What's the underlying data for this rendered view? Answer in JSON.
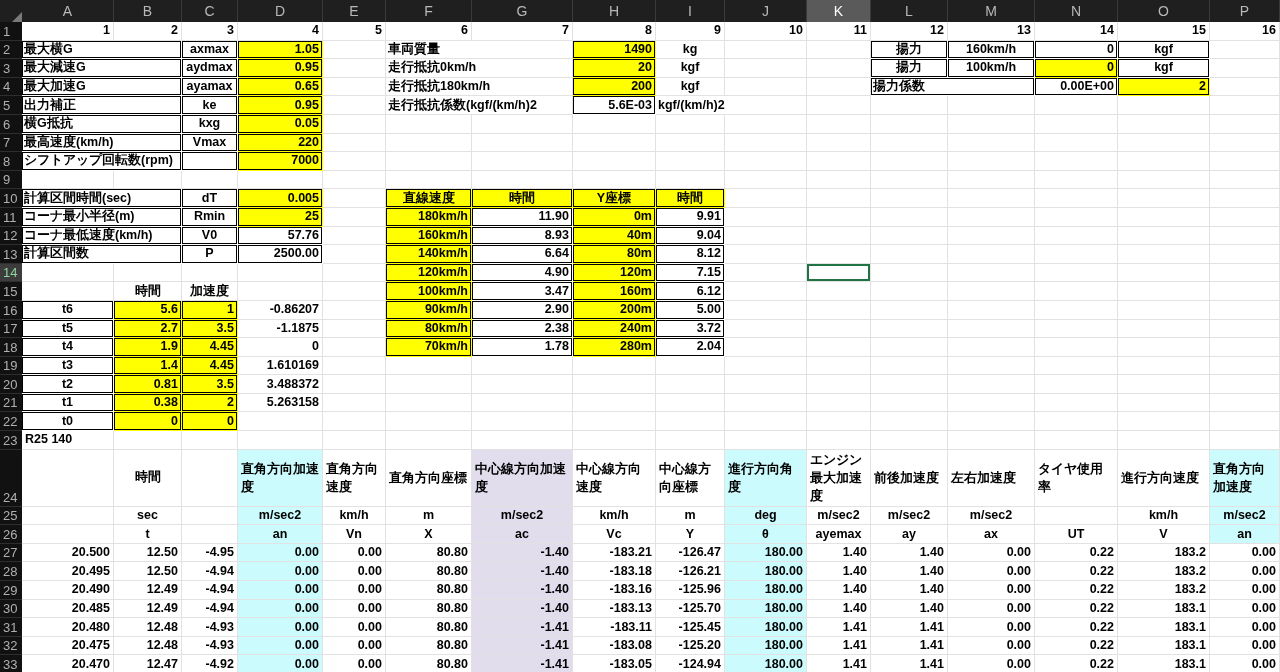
{
  "columns": [
    {
      "label": "A",
      "selected": false
    },
    {
      "label": "B",
      "selected": false
    },
    {
      "label": "C",
      "selected": false
    },
    {
      "label": "D",
      "selected": false
    },
    {
      "label": "E",
      "selected": false
    },
    {
      "label": "F",
      "selected": false
    },
    {
      "label": "G",
      "selected": false
    },
    {
      "label": "H",
      "selected": false
    },
    {
      "label": "I",
      "selected": false
    },
    {
      "label": "J",
      "selected": false
    },
    {
      "label": "K",
      "selected": true
    },
    {
      "label": "L",
      "selected": false
    },
    {
      "label": "M",
      "selected": false
    },
    {
      "label": "N",
      "selected": false
    },
    {
      "label": "O",
      "selected": false
    },
    {
      "label": "P",
      "selected": false
    }
  ],
  "rows": [
    {
      "number": "1",
      "selected": false,
      "cells": [
        {
          "text": "1",
          "kind": "number"
        },
        {
          "text": "2",
          "kind": "number"
        },
        {
          "text": "3",
          "kind": "number"
        },
        {
          "text": "4",
          "kind": "number"
        },
        {
          "text": "5",
          "kind": "number"
        },
        {
          "text": "6",
          "kind": "number"
        },
        {
          "text": "7",
          "kind": "number"
        },
        {
          "text": "8",
          "kind": "number"
        },
        {
          "text": "9",
          "kind": "number"
        },
        {
          "text": "10",
          "kind": "number"
        },
        {
          "text": "11",
          "kind": "number"
        },
        {
          "text": "12",
          "kind": "number"
        },
        {
          "text": "13",
          "kind": "number"
        },
        {
          "text": "14",
          "kind": "number"
        },
        {
          "text": "15",
          "kind": "number"
        },
        {
          "text": "16",
          "kind": "number"
        }
      ]
    },
    {
      "number": "2",
      "selected": false,
      "cells": [
        {
          "text": "最大横G",
          "kind": "merged_label",
          "boxed": true
        },
        {
          "text": "axmax",
          "kind": "heading",
          "boxed": true
        },
        {
          "text": "1.05",
          "kind": "number",
          "boxed": true,
          "color": "#ffff00"
        },
        null,
        {
          "text": "車両質量",
          "kind": "merged_label"
        },
        {
          "text": "1490",
          "kind": "number",
          "boxed": true,
          "color": "#ffff00"
        },
        {
          "text": "kg",
          "kind": "heading"
        },
        null,
        null,
        {
          "text": "揚力",
          "kind": "heading",
          "boxed": true
        },
        {
          "text": "160km/h",
          "kind": "heading",
          "boxed": true
        },
        {
          "text": "0",
          "kind": "number",
          "boxed": true
        },
        {
          "text": "kgf",
          "kind": "heading",
          "boxed": true
        },
        null
      ]
    },
    {
      "number": "3",
      "selected": false,
      "cells": [
        {
          "text": "最大減速G",
          "kind": "merged_label",
          "boxed": true
        },
        {
          "text": "aydmax",
          "kind": "heading",
          "boxed": true
        },
        {
          "text": "0.95",
          "kind": "number",
          "boxed": true,
          "color": "#ffff00"
        },
        null,
        {
          "text": "走行抵抗0km/h",
          "kind": "merged_label"
        },
        {
          "text": "20",
          "kind": "number",
          "boxed": true,
          "color": "#ffff00"
        },
        {
          "text": "kgf",
          "kind": "heading"
        },
        null,
        null,
        {
          "text": "揚力",
          "kind": "heading",
          "boxed": true
        },
        {
          "text": "100km/h",
          "kind": "heading",
          "boxed": true
        },
        {
          "text": "0",
          "kind": "number",
          "boxed": true,
          "color": "#ffff00"
        },
        {
          "text": "kgf",
          "kind": "heading",
          "boxed": true
        },
        null
      ]
    },
    {
      "number": "4",
      "selected": false,
      "cells": [
        {
          "text": "最大加速G",
          "kind": "merged_label",
          "boxed": true
        },
        {
          "text": "ayamax",
          "kind": "heading",
          "boxed": true
        },
        {
          "text": "0.65",
          "kind": "number",
          "boxed": true,
          "color": "#ffff00"
        },
        null,
        {
          "text": "走行抵抗180km/h",
          "kind": "merged_label"
        },
        {
          "text": "200",
          "kind": "number",
          "boxed": true,
          "color": "#ffff00"
        },
        {
          "text": "kgf",
          "kind": "heading"
        },
        null,
        null,
        {
          "text": "揚力係数",
          "kind": "merged_label",
          "boxed": true
        },
        {
          "text": "0.00E+00",
          "kind": "number",
          "boxed": true
        },
        {
          "text": "2",
          "kind": "number",
          "boxed": true,
          "color": "#ffff00"
        },
        null
      ]
    },
    {
      "number": "5",
      "selected": false,
      "cells": [
        {
          "text": "出力補正",
          "kind": "merged_label",
          "boxed": true
        },
        {
          "text": "ke",
          "kind": "heading",
          "boxed": true
        },
        {
          "text": "0.95",
          "kind": "number",
          "boxed": true,
          "color": "#ffff00"
        },
        null,
        {
          "text": "走行抵抗係数(kgf/(km/h)2",
          "kind": "merged_label"
        },
        {
          "text": "5.6E-03",
          "kind": "number",
          "boxed": true
        },
        {
          "text": "kgf/(km/h)2",
          "kind": "merged_label"
        }
      ]
    },
    {
      "number": "6",
      "selected": false,
      "cells": [
        {
          "text": "横G抵抗",
          "kind": "merged_label",
          "boxed": true
        },
        {
          "text": "kxg",
          "kind": "heading",
          "boxed": true
        },
        {
          "text": "0.05",
          "kind": "number",
          "boxed": true,
          "color": "#ffff00"
        }
      ]
    },
    {
      "number": "7",
      "selected": false,
      "cells": [
        {
          "text": "最高速度(km/h)",
          "kind": "merged_label",
          "boxed": true
        },
        {
          "text": "Vmax",
          "kind": "heading",
          "boxed": true
        },
        {
          "text": "220",
          "kind": "number",
          "boxed": true,
          "color": "#ffff00"
        }
      ]
    },
    {
      "number": "8",
      "selected": false,
      "cells": [
        {
          "text": "シフトアップ回転数(rpm)",
          "kind": "merged_label",
          "boxed": true
        },
        {
          "boxed": true
        },
        {
          "text": "7000",
          "kind": "number",
          "boxed": true,
          "color": "#ffff00"
        }
      ]
    },
    {
      "number": "9",
      "selected": false
    },
    {
      "number": "10",
      "selected": false,
      "cells": [
        {
          "text": "計算区間時間(sec)",
          "kind": "merged_label",
          "boxed": true
        },
        {
          "text": "dT",
          "kind": "heading",
          "boxed": true
        },
        {
          "text": "0.005",
          "kind": "number",
          "boxed": true,
          "color": "#ffff00"
        },
        null,
        {
          "text": "直線速度",
          "kind": "heading",
          "boxed": true,
          "color": "#ffff00"
        },
        {
          "text": "時間",
          "kind": "heading",
          "boxed": true,
          "color": "#ffff00"
        },
        {
          "text": "Y座標",
          "kind": "heading",
          "boxed": true,
          "color": "#ffff00"
        },
        {
          "text": "時間",
          "kind": "heading",
          "boxed": true,
          "color": "#ffff00"
        }
      ]
    },
    {
      "number": "11",
      "selected": false,
      "cells": [
        {
          "text": "コーナ最小半径(m)",
          "kind": "merged_label",
          "boxed": true
        },
        {
          "text": "Rmin",
          "kind": "heading",
          "boxed": true
        },
        {
          "text": "25",
          "kind": "number",
          "boxed": true,
          "color": "#ffff00"
        },
        null,
        {
          "text": "180km/h",
          "kind": "number",
          "boxed": true,
          "color": "#ffff00"
        },
        {
          "text": "11.90",
          "kind": "number",
          "boxed": true
        },
        {
          "text": "0m",
          "kind": "number",
          "boxed": true,
          "color": "#ffff00"
        },
        {
          "text": "9.91",
          "kind": "number",
          "boxed": true
        }
      ]
    },
    {
      "number": "12",
      "selected": false,
      "cells": [
        {
          "text": "コーナ最低速度(km/h)",
          "kind": "merged_label",
          "boxed": true
        },
        {
          "text": "V0",
          "kind": "heading",
          "boxed": true
        },
        {
          "text": "57.76",
          "kind": "number",
          "boxed": true
        },
        null,
        {
          "text": "160km/h",
          "kind": "number",
          "boxed": true,
          "color": "#ffff00"
        },
        {
          "text": "8.93",
          "kind": "number",
          "boxed": true
        },
        {
          "text": "40m",
          "kind": "number",
          "boxed": true,
          "color": "#ffff00"
        },
        {
          "text": "9.04",
          "kind": "number",
          "boxed": true
        }
      ]
    },
    {
      "number": "13",
      "selected": false,
      "cells": [
        {
          "text": "計算区間数",
          "kind": "merged_label",
          "boxed": true
        },
        {
          "text": "P",
          "kind": "heading",
          "boxed": true
        },
        {
          "text": "2500.00",
          "kind": "number",
          "boxed": true
        },
        null,
        {
          "text": "140km/h",
          "kind": "number",
          "boxed": true,
          "color": "#ffff00"
        },
        {
          "text": "6.64",
          "kind": "number",
          "boxed": true
        },
        {
          "text": "80m",
          "kind": "number",
          "boxed": true,
          "color": "#ffff00"
        },
        {
          "text": "8.12",
          "kind": "number",
          "boxed": true
        }
      ]
    },
    {
      "number": "14",
      "selected": true,
      "cells": [
        null,
        null,
        null,
        null,
        null,
        {
          "text": "120km/h",
          "kind": "number",
          "boxed": true,
          "color": "#ffff00"
        },
        {
          "text": "4.90",
          "kind": "number",
          "boxed": true
        },
        {
          "text": "120m",
          "kind": "number",
          "boxed": true,
          "color": "#ffff00"
        },
        {
          "text": "7.15",
          "kind": "number",
          "boxed": true
        }
      ]
    },
    {
      "number": "15",
      "selected": false,
      "cells": [
        null,
        {
          "text": "時間",
          "kind": "heading"
        },
        {
          "text": "加速度",
          "kind": "heading"
        },
        null,
        null,
        {
          "text": "100km/h",
          "kind": "number",
          "boxed": true,
          "color": "#ffff00"
        },
        {
          "text": "3.47",
          "kind": "number",
          "boxed": true
        },
        {
          "text": "160m",
          "kind": "number",
          "boxed": true,
          "color": "#ffff00"
        },
        {
          "text": "6.12",
          "kind": "number",
          "boxed": true
        }
      ]
    },
    {
      "number": "16",
      "selected": false,
      "cells": [
        {
          "text": "t6",
          "kind": "heading",
          "boxed": true
        },
        {
          "text": "5.6",
          "kind": "number",
          "boxed": true,
          "color": "#ffff00"
        },
        {
          "text": "1",
          "kind": "number",
          "boxed": true,
          "color": "#ffff00"
        },
        {
          "text": "-0.86207",
          "kind": "number"
        },
        null,
        {
          "text": "90km/h",
          "kind": "number",
          "boxed": true,
          "color": "#ffff00"
        },
        {
          "text": "2.90",
          "kind": "number",
          "boxed": true
        },
        {
          "text": "200m",
          "kind": "number",
          "boxed": true,
          "color": "#ffff00"
        },
        {
          "text": "5.00",
          "kind": "number",
          "boxed": true
        }
      ]
    },
    {
      "number": "17",
      "selected": false,
      "cells": [
        {
          "text": "t5",
          "kind": "heading",
          "boxed": true
        },
        {
          "text": "2.7",
          "kind": "number",
          "boxed": true,
          "color": "#ffff00"
        },
        {
          "text": "3.5",
          "kind": "number",
          "boxed": true,
          "color": "#ffff00"
        },
        {
          "text": "-1.1875",
          "kind": "number"
        },
        null,
        {
          "text": "80km/h",
          "kind": "number",
          "boxed": true,
          "color": "#ffff00"
        },
        {
          "text": "2.38",
          "kind": "number",
          "boxed": true
        },
        {
          "text": "240m",
          "kind": "number",
          "boxed": true,
          "color": "#ffff00"
        },
        {
          "text": "3.72",
          "kind": "number",
          "boxed": true
        }
      ]
    },
    {
      "number": "18",
      "selected": false,
      "cells": [
        {
          "text": "t4",
          "kind": "heading",
          "boxed": true
        },
        {
          "text": "1.9",
          "kind": "number",
          "boxed": true,
          "color": "#ffff00"
        },
        {
          "text": "4.45",
          "kind": "number",
          "boxed": true,
          "color": "#ffff00"
        },
        {
          "text": "0",
          "kind": "number"
        },
        null,
        {
          "text": "70km/h",
          "kind": "number",
          "boxed": true,
          "color": "#ffff00"
        },
        {
          "text": "1.78",
          "kind": "number",
          "boxed": true
        },
        {
          "text": "280m",
          "kind": "number",
          "boxed": true,
          "color": "#ffff00"
        },
        {
          "text": "2.04",
          "kind": "number",
          "boxed": true
        }
      ]
    },
    {
      "number": "19",
      "selected": false,
      "cells": [
        {
          "text": "t3",
          "kind": "heading",
          "boxed": true
        },
        {
          "text": "1.4",
          "kind": "number",
          "boxed": true,
          "color": "#ffff00"
        },
        {
          "text": "4.45",
          "kind": "number",
          "boxed": true,
          "color": "#ffff00"
        },
        {
          "text": "1.610169",
          "kind": "number"
        }
      ]
    },
    {
      "number": "20",
      "selected": false,
      "cells": [
        {
          "text": "t2",
          "kind": "heading",
          "boxed": true
        },
        {
          "text": "0.81",
          "kind": "number",
          "boxed": true,
          "color": "#ffff00"
        },
        {
          "text": "3.5",
          "kind": "number",
          "boxed": true,
          "color": "#ffff00"
        },
        {
          "text": "3.488372",
          "kind": "number"
        }
      ]
    },
    {
      "number": "21",
      "selected": false,
      "cells": [
        {
          "text": "t1",
          "kind": "heading",
          "boxed": true
        },
        {
          "text": "0.38",
          "kind": "number",
          "boxed": true,
          "color": "#ffff00"
        },
        {
          "text": "2",
          "kind": "number",
          "boxed": true,
          "color": "#ffff00"
        },
        {
          "text": "5.263158",
          "kind": "number"
        }
      ]
    },
    {
      "number": "22",
      "selected": false,
      "cells": [
        {
          "text": "t0",
          "kind": "heading",
          "boxed": true
        },
        {
          "text": "0",
          "kind": "number",
          "boxed": true,
          "color": "#ffff00"
        },
        {
          "text": "0",
          "kind": "number",
          "boxed": true,
          "color": "#ffff00"
        }
      ]
    },
    {
      "number": "23",
      "selected": false,
      "cells": [
        {
          "text": "R25 140",
          "kind": "label"
        }
      ]
    },
    {
      "number": "24",
      "selected": false,
      "cells": [
        null,
        {
          "text": "時間",
          "kind": "heading"
        },
        null,
        {
          "text": "直角方向加速度",
          "kind": "caption",
          "color": "#ccfbfd"
        },
        {
          "text": "直角方向速度",
          "kind": "caption"
        },
        {
          "text": "直角方向座標",
          "kind": "caption"
        },
        {
          "text": "中心線方向加速度",
          "kind": "caption",
          "color": "#e1dded"
        },
        {
          "text": "中心線方向速度",
          "kind": "caption"
        },
        {
          "text": "中心線方向座標",
          "kind": "caption"
        },
        {
          "text": "進行方向角度",
          "kind": "caption",
          "color": "#ccfbfd"
        },
        {
          "text": "エンジン最大加速度",
          "kind": "caption"
        },
        {
          "text": "前後加速度",
          "kind": "caption"
        },
        {
          "text": "左右加速度",
          "kind": "caption"
        },
        {
          "text": "タイヤ使用率",
          "kind": "caption"
        },
        {
          "text": "進行方向速度",
          "kind": "caption"
        },
        {
          "text": "直角方向加速度",
          "kind": "caption",
          "color": "#ccfbfd"
        }
      ]
    },
    {
      "number": "25",
      "selected": false,
      "cells": [
        null,
        {
          "text": "sec",
          "kind": "heading"
        },
        null,
        {
          "text": "m/sec2",
          "kind": "heading",
          "color": "#ccfbfd"
        },
        {
          "text": "km/h",
          "kind": "heading"
        },
        {
          "text": "m",
          "kind": "heading"
        },
        {
          "text": "m/sec2",
          "kind": "heading",
          "color": "#e1dded"
        },
        {
          "text": "km/h",
          "kind": "heading"
        },
        {
          "text": "m",
          "kind": "heading"
        },
        {
          "text": "deg",
          "kind": "heading",
          "color": "#ccfbfd"
        },
        {
          "text": "m/sec2",
          "kind": "heading"
        },
        {
          "text": "m/sec2",
          "kind": "heading"
        },
        {
          "text": "m/sec2",
          "kind": "heading"
        },
        null,
        {
          "text": "km/h",
          "kind": "heading"
        },
        {
          "text": "m/sec2",
          "kind": "heading",
          "color": "#ccfbfd"
        }
      ]
    },
    {
      "number": "26",
      "selected": false,
      "cells": [
        null,
        {
          "text": "t",
          "kind": "heading"
        },
        null,
        {
          "text": "an",
          "kind": "heading",
          "color": "#ccfbfd"
        },
        {
          "text": "Vn",
          "kind": "heading"
        },
        {
          "text": "X",
          "kind": "heading"
        },
        {
          "text": "ac",
          "kind": "heading",
          "color": "#e1dded"
        },
        {
          "text": "Vc",
          "kind": "heading"
        },
        {
          "text": "Y",
          "kind": "heading"
        },
        {
          "text": "θ",
          "kind": "heading",
          "color": "#ccfbfd"
        },
        {
          "text": "ayemax",
          "kind": "heading"
        },
        {
          "text": "ay",
          "kind": "heading"
        },
        {
          "text": "ax",
          "kind": "heading"
        },
        {
          "text": "UT",
          "kind": "heading"
        },
        {
          "text": "V",
          "kind": "heading"
        },
        {
          "text": "an",
          "kind": "heading",
          "color": "#ccfbfd"
        }
      ]
    },
    {
      "number": "27",
      "selected": false,
      "cells": [
        {
          "text": "20.500",
          "kind": "number"
        },
        {
          "text": "12.50",
          "kind": "number"
        },
        {
          "text": "-4.95",
          "kind": "number"
        },
        {
          "text": "0.00",
          "kind": "number",
          "color": "#ccfbfd"
        },
        {
          "text": "0.00",
          "kind": "number"
        },
        {
          "text": "80.80",
          "kind": "number"
        },
        {
          "text": "-1.40",
          "kind": "number",
          "color": "#e1dded"
        },
        {
          "text": "-183.21",
          "kind": "number"
        },
        {
          "text": "-126.47",
          "kind": "number"
        },
        {
          "text": "180.00",
          "kind": "number",
          "color": "#ccfbfd"
        },
        {
          "text": "1.40",
          "kind": "number"
        },
        {
          "text": "1.40",
          "kind": "number"
        },
        {
          "text": "0.00",
          "kind": "number"
        },
        {
          "text": "0.22",
          "kind": "number"
        },
        {
          "text": "183.2",
          "kind": "number"
        },
        {
          "text": "0.00",
          "kind": "number"
        }
      ]
    },
    {
      "number": "28",
      "selected": false,
      "cells": [
        {
          "text": "20.495",
          "kind": "number"
        },
        {
          "text": "12.50",
          "kind": "number"
        },
        {
          "text": "-4.94",
          "kind": "number"
        },
        {
          "text": "0.00",
          "kind": "number",
          "color": "#ccfbfd"
        },
        {
          "text": "0.00",
          "kind": "number"
        },
        {
          "text": "80.80",
          "kind": "number"
        },
        {
          "text": "-1.40",
          "kind": "number",
          "color": "#e1dded"
        },
        {
          "text": "-183.18",
          "kind": "number"
        },
        {
          "text": "-126.21",
          "kind": "number"
        },
        {
          "text": "180.00",
          "kind": "number",
          "color": "#ccfbfd"
        },
        {
          "text": "1.40",
          "kind": "number"
        },
        {
          "text": "1.40",
          "kind": "number"
        },
        {
          "text": "0.00",
          "kind": "number"
        },
        {
          "text": "0.22",
          "kind": "number"
        },
        {
          "text": "183.2",
          "kind": "number"
        },
        {
          "text": "0.00",
          "kind": "number"
        }
      ]
    },
    {
      "number": "29",
      "selected": false,
      "cells": [
        {
          "text": "20.490",
          "kind": "number"
        },
        {
          "text": "12.49",
          "kind": "number"
        },
        {
          "text": "-4.94",
          "kind": "number"
        },
        {
          "text": "0.00",
          "kind": "number",
          "color": "#ccfbfd"
        },
        {
          "text": "0.00",
          "kind": "number"
        },
        {
          "text": "80.80",
          "kind": "number"
        },
        {
          "text": "-1.40",
          "kind": "number",
          "color": "#e1dded"
        },
        {
          "text": "-183.16",
          "kind": "number"
        },
        {
          "text": "-125.96",
          "kind": "number"
        },
        {
          "text": "180.00",
          "kind": "number",
          "color": "#ccfbfd"
        },
        {
          "text": "1.40",
          "kind": "number"
        },
        {
          "text": "1.40",
          "kind": "number"
        },
        {
          "text": "0.00",
          "kind": "number"
        },
        {
          "text": "0.22",
          "kind": "number"
        },
        {
          "text": "183.2",
          "kind": "number"
        },
        {
          "text": "0.00",
          "kind": "number"
        }
      ]
    },
    {
      "number": "30",
      "selected": false,
      "cells": [
        {
          "text": "20.485",
          "kind": "number"
        },
        {
          "text": "12.49",
          "kind": "number"
        },
        {
          "text": "-4.94",
          "kind": "number"
        },
        {
          "text": "0.00",
          "kind": "number",
          "color": "#ccfbfd"
        },
        {
          "text": "0.00",
          "kind": "number"
        },
        {
          "text": "80.80",
          "kind": "number"
        },
        {
          "text": "-1.40",
          "kind": "number",
          "color": "#e1dded"
        },
        {
          "text": "-183.13",
          "kind": "number"
        },
        {
          "text": "-125.70",
          "kind": "number"
        },
        {
          "text": "180.00",
          "kind": "number",
          "color": "#ccfbfd"
        },
        {
          "text": "1.40",
          "kind": "number"
        },
        {
          "text": "1.40",
          "kind": "number"
        },
        {
          "text": "0.00",
          "kind": "number"
        },
        {
          "text": "0.22",
          "kind": "number"
        },
        {
          "text": "183.1",
          "kind": "number"
        },
        {
          "text": "0.00",
          "kind": "number"
        }
      ]
    },
    {
      "number": "31",
      "selected": false,
      "cells": [
        {
          "text": "20.480",
          "kind": "number"
        },
        {
          "text": "12.48",
          "kind": "number"
        },
        {
          "text": "-4.93",
          "kind": "number"
        },
        {
          "text": "0.00",
          "kind": "number",
          "color": "#ccfbfd"
        },
        {
          "text": "0.00",
          "kind": "number"
        },
        {
          "text": "80.80",
          "kind": "number"
        },
        {
          "text": "-1.41",
          "kind": "number",
          "color": "#e1dded"
        },
        {
          "text": "-183.11",
          "kind": "number"
        },
        {
          "text": "-125.45",
          "kind": "number"
        },
        {
          "text": "180.00",
          "kind": "number",
          "color": "#ccfbfd"
        },
        {
          "text": "1.41",
          "kind": "number"
        },
        {
          "text": "1.41",
          "kind": "number"
        },
        {
          "text": "0.00",
          "kind": "number"
        },
        {
          "text": "0.22",
          "kind": "number"
        },
        {
          "text": "183.1",
          "kind": "number"
        },
        {
          "text": "0.00",
          "kind": "number"
        }
      ]
    },
    {
      "number": "32",
      "selected": false,
      "cells": [
        {
          "text": "20.475",
          "kind": "number"
        },
        {
          "text": "12.48",
          "kind": "number"
        },
        {
          "text": "-4.93",
          "kind": "number"
        },
        {
          "text": "0.00",
          "kind": "number",
          "color": "#ccfbfd"
        },
        {
          "text": "0.00",
          "kind": "number"
        },
        {
          "text": "80.80",
          "kind": "number"
        },
        {
          "text": "-1.41",
          "kind": "number",
          "color": "#e1dded"
        },
        {
          "text": "-183.08",
          "kind": "number"
        },
        {
          "text": "-125.20",
          "kind": "number"
        },
        {
          "text": "180.00",
          "kind": "number",
          "color": "#ccfbfd"
        },
        {
          "text": "1.41",
          "kind": "number"
        },
        {
          "text": "1.41",
          "kind": "number"
        },
        {
          "text": "0.00",
          "kind": "number"
        },
        {
          "text": "0.22",
          "kind": "number"
        },
        {
          "text": "183.1",
          "kind": "number"
        },
        {
          "text": "0.00",
          "kind": "number"
        }
      ]
    },
    {
      "number": "33",
      "selected": false,
      "cells": [
        {
          "text": "20.470",
          "kind": "number"
        },
        {
          "text": "12.47",
          "kind": "number"
        },
        {
          "text": "-4.92",
          "kind": "number"
        },
        {
          "text": "0.00",
          "kind": "number",
          "color": "#ccfbfd"
        },
        {
          "text": "0.00",
          "kind": "number"
        },
        {
          "text": "80.80",
          "kind": "number"
        },
        {
          "text": "-1.41",
          "kind": "number",
          "color": "#e1dded"
        },
        {
          "text": "-183.05",
          "kind": "number"
        },
        {
          "text": "-124.94",
          "kind": "number"
        },
        {
          "text": "180.00",
          "kind": "number",
          "color": "#ccfbfd"
        },
        {
          "text": "1.41",
          "kind": "number"
        },
        {
          "text": "1.41",
          "kind": "number"
        },
        {
          "text": "0.00",
          "kind": "number"
        },
        {
          "text": "0.22",
          "kind": "number"
        },
        {
          "text": "183.1",
          "kind": "number"
        },
        {
          "text": "0.00",
          "kind": "number"
        }
      ]
    }
  ]
}
